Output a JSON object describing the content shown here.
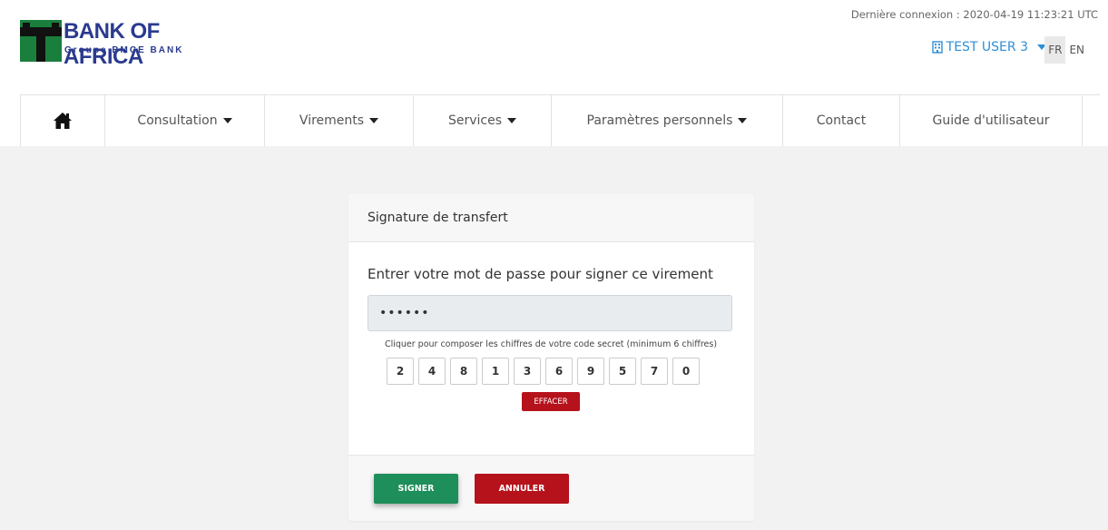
{
  "header": {
    "logo_brand": "BANK OF AFRICA",
    "logo_group": "Groupe BMCE BANK",
    "last_login": "Dernière connexion : 2020-04-19 11:23:21 UTC",
    "user_name": "TEST USER 3",
    "languages": [
      "FR",
      "EN"
    ],
    "active_language": "FR"
  },
  "nav": {
    "items": [
      {
        "label": "Consultation",
        "dropdown": true
      },
      {
        "label": "Virements",
        "dropdown": true
      },
      {
        "label": "Services",
        "dropdown": true
      },
      {
        "label": "Paramètres personnels",
        "dropdown": true
      },
      {
        "label": "Contact",
        "dropdown": false
      },
      {
        "label": "Guide d'utilisateur",
        "dropdown": false
      }
    ]
  },
  "card": {
    "title": "Signature de transfert",
    "prompt": "Entrer votre mot de passe pour signer ce virement",
    "password_value": "••••••",
    "hint": "Cliquer pour composer les chiffres de votre code secret (minimum 6 chiffres)",
    "keys": [
      "2",
      "4",
      "8",
      "1",
      "3",
      "6",
      "9",
      "5",
      "7",
      "0"
    ],
    "clear_label": "EFFACER",
    "sign_label": "SIGNER",
    "cancel_label": "ANNULER"
  },
  "colors": {
    "brand_blue": "#2a3a8f",
    "brand_green": "#1a7f3c",
    "accent_blue": "#2f8fd6",
    "danger_red": "#b5121b",
    "success_green": "#1e8e5a"
  }
}
